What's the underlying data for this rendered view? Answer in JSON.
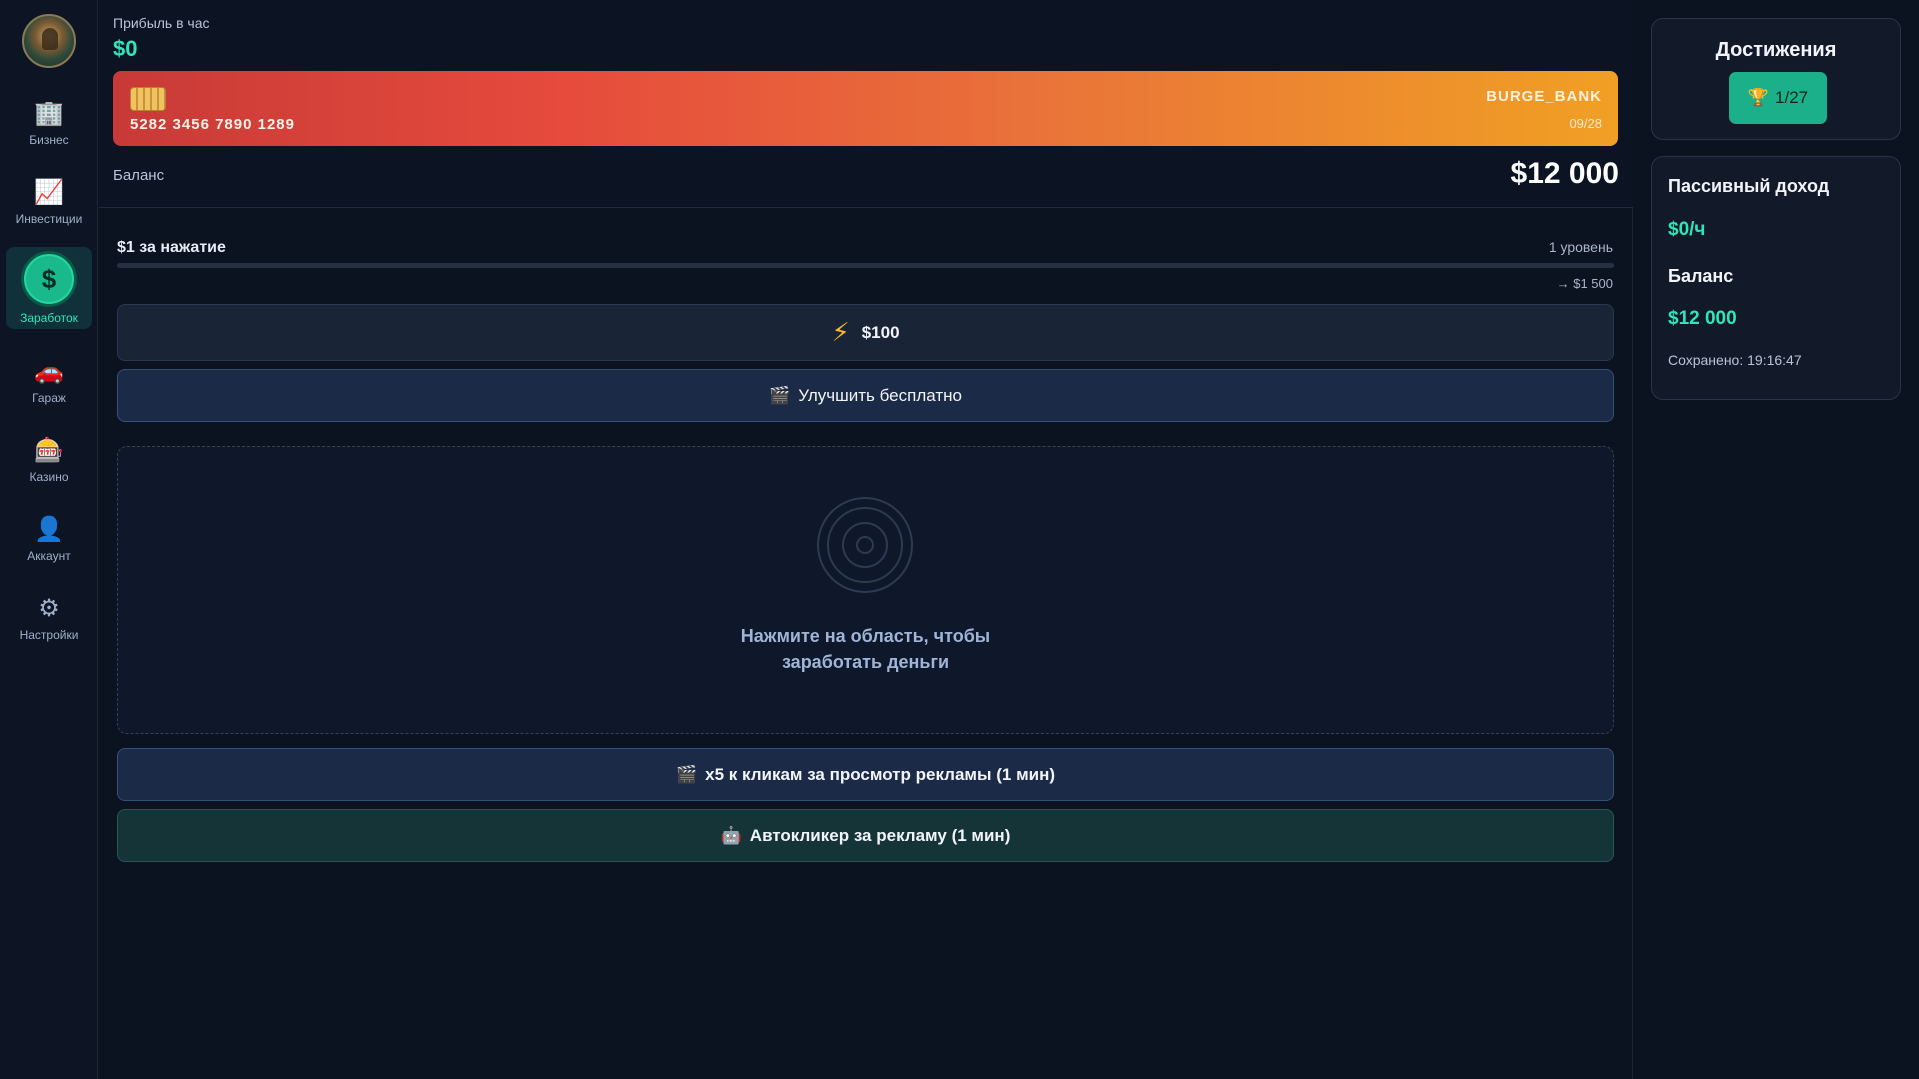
{
  "sidebar": {
    "items": [
      {
        "label": "Бизнес",
        "icon": "🏢"
      },
      {
        "label": "Инвестиции",
        "icon": "📈"
      },
      {
        "label": "Заработок",
        "icon": "$"
      },
      {
        "label": "Гараж",
        "icon": "🚗"
      },
      {
        "label": "Казино",
        "icon": "🎰"
      },
      {
        "label": "Аккаунт",
        "icon": "👤"
      },
      {
        "label": "Настройки",
        "icon": "⚙"
      }
    ],
    "active": "Заработок"
  },
  "header": {
    "profit_label": "Прибыль в час",
    "profit_value": "$0",
    "card": {
      "number": "5282 3456 7890 1289",
      "bank": "BURGE_BANK",
      "expiry": "09/28"
    },
    "balance_label": "Баланс",
    "balance_value": "$12 000"
  },
  "earn": {
    "click_rate": "$1 за нажатие",
    "level": "1 уровень",
    "progress": 0,
    "next_cost": "→ $1 500",
    "upgrade_icon": "⚡",
    "upgrade_price": "$100",
    "free_upgrade_icon": "🎬",
    "free_upgrade_label": "Улучшить бесплатно",
    "zone_text_line1": "Нажмите на область, чтобы",
    "zone_text_line2": "заработать деньги",
    "ad_icon": "🎬",
    "ad_label": "x5 к кликам за просмотр рекламы (1 мин)",
    "auto_icon": "🤖",
    "auto_label": "Автокликер за рекламу (1 мин)"
  },
  "achievements": {
    "title": "Достижения",
    "icon": "🏆",
    "count": "1/27"
  },
  "passive": {
    "title": "Пассивный доход",
    "income": "$0/ч",
    "balance_title": "Баланс",
    "balance": "$12 000",
    "saved": "Сохранено: 19:16:47"
  },
  "colors": {
    "accent": "#2ee6b8",
    "background": "#0b1220",
    "card_gradient_start": "#c83a37",
    "card_gradient_end": "#f0a024"
  }
}
